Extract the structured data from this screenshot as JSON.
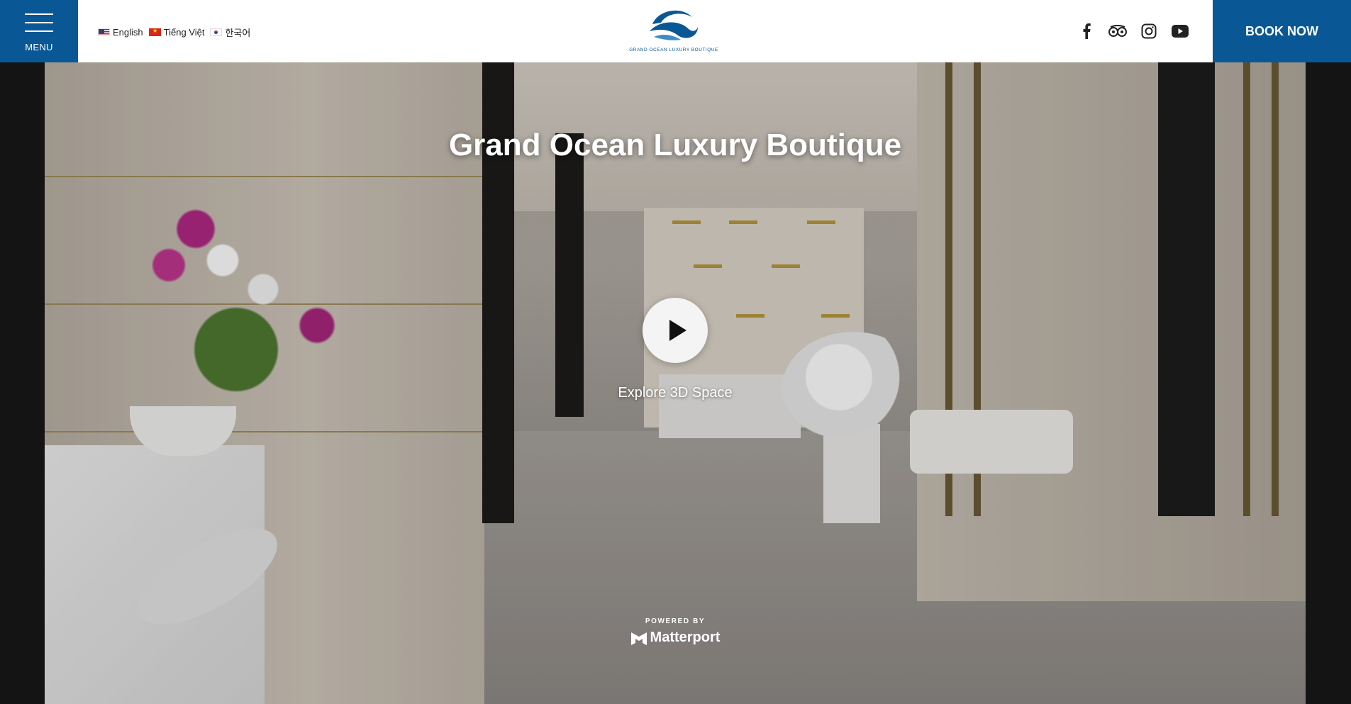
{
  "header": {
    "menu_label": "MENU",
    "languages": [
      {
        "label": "English",
        "flag": "us-flag"
      },
      {
        "label": "Tiếng Việt",
        "flag": "vn-flag"
      },
      {
        "label": "한국어",
        "flag": "kr-flag"
      }
    ],
    "logo_text": "GRAND OCEAN LUXURY BOUTIQUE",
    "socials": [
      "facebook-icon",
      "tripadvisor-icon",
      "instagram-icon",
      "youtube-icon"
    ],
    "book_label": "BOOK NOW",
    "accent_color": "#0a5796"
  },
  "hero": {
    "title": "Grand Ocean Luxury Boutique",
    "explore_label": "Explore 3D Space",
    "powered_by": "POWERED BY",
    "brand": "Matterport"
  }
}
